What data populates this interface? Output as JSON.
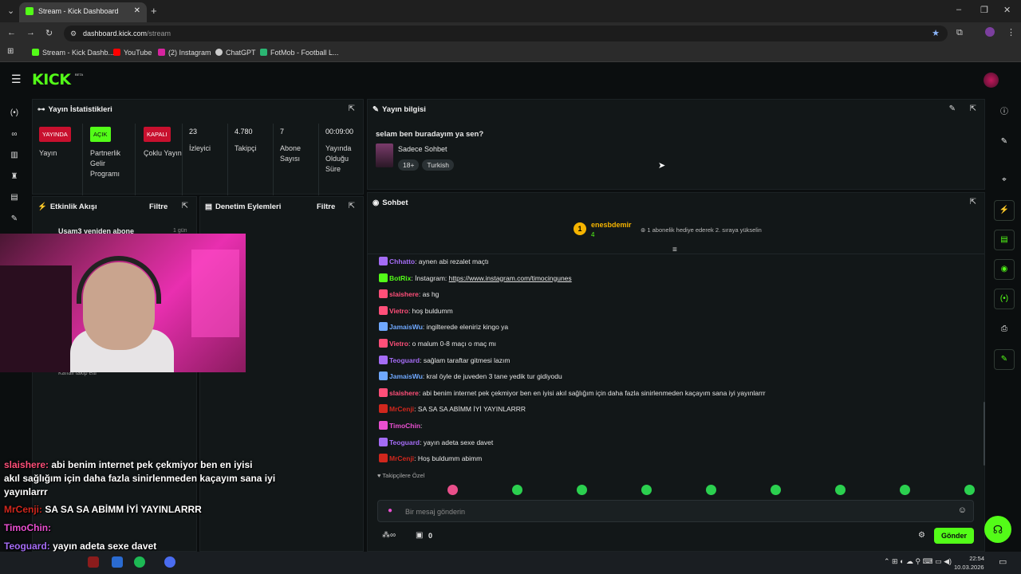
{
  "browser": {
    "tab_title": "Stream - Kick Dashboard",
    "url_host": "dashboard.kick.com",
    "url_path": "/stream",
    "bookmarks": [
      "Stream - Kick Dashb...",
      "YouTube",
      "(2) Instagram",
      "ChatGPT",
      "FotMob - Football L..."
    ]
  },
  "app": {
    "logo": "KICK",
    "beta": "BETA"
  },
  "stats": {
    "title": "Yayın İstatistikleri",
    "items": [
      {
        "badge": "YAYINDA",
        "label": "Yayın",
        "color": "#c8102e"
      },
      {
        "badge": "AÇIK",
        "label": "Partnerlik Gelir Programı",
        "color": "#53fc18"
      },
      {
        "badge": "KAPALI",
        "label": "Çoklu Yayın",
        "color": "#c8102e"
      },
      {
        "value": "23",
        "label": "İzleyici"
      },
      {
        "value": "4.780",
        "label": "Takipçi"
      },
      {
        "value": "7",
        "label": "Abone Sayısı"
      },
      {
        "value": "00:09:00",
        "label": "Yayında Olduğu Süre"
      }
    ]
  },
  "info": {
    "title": "Yayın bilgisi",
    "stream_title": "selam ben buradayım ya sen?",
    "category": "Sadece Sohbet",
    "tags": [
      "18+",
      "Turkish"
    ]
  },
  "activity": {
    "title": "Etkinlik Akışı",
    "filter": "Filtre",
    "first_item": "Usam3 yeniden abone",
    "first_time": "1 gün",
    "partial_item": "Kanalı takip etti"
  },
  "moderation": {
    "title": "Denetim Eylemleri",
    "filter": "Filtre"
  },
  "chat": {
    "title": "Sohbet",
    "top_gifter": "enesbdemir",
    "top_gifter_count": "4",
    "gift_hint": "1 abonelik hediye ederek 2. sıraya yükselin",
    "messages": [
      {
        "user": "Chhatto",
        "text": "aynen abi rezalet maçtı",
        "color": "#a46cf5"
      },
      {
        "user": "BotRix",
        "text": "İnstagram: ",
        "link": "https://www.instagram.com/timocingunes",
        "color": "#53fc18"
      },
      {
        "user": "slaishere",
        "text": "as hg",
        "color": "#ff4f79"
      },
      {
        "user": "Vietro",
        "text": "hoş buldumm",
        "color": "#ff4f79"
      },
      {
        "user": "JamaisWu",
        "text": "ingilterede eleniriz kingo ya",
        "color": "#6fa8ff"
      },
      {
        "user": "Vietro",
        "text": "o malum 0-8 maçı o maç mı",
        "color": "#ff4f79"
      },
      {
        "user": "Teoguard",
        "text": "sağlam taraftar gitmesi lazım",
        "color": "#a46cf5"
      },
      {
        "user": "JamaisWu",
        "text": "kral öyle de juveden 3 tane yedik tur gidiyodu",
        "color": "#6fa8ff"
      },
      {
        "user": "slaishere",
        "text": "abi benim internet pek çekmiyor ben en iyisi akıl sağlığım için daha fazla sinirlenmeden kaçayım sana iyi yayınlarrr",
        "color": "#ff4f79"
      },
      {
        "user": "MrCenji",
        "text": "SA SA SA ABİMM İYİ YAYINLARRR",
        "color": "#d0271d"
      },
      {
        "user": "TimoChin",
        "text": "",
        "color": "#e94fd0"
      },
      {
        "user": "Teoguard",
        "text": "yayın adeta sexe davet",
        "color": "#a46cf5"
      },
      {
        "user": "MrCenji",
        "text": "Hoş buldumm abimm",
        "color": "#d0271d"
      }
    ],
    "emote_label": "Takipçilere Özel",
    "input_placeholder": "Bir mesaj gönderin",
    "points": "0",
    "send": "Gönder"
  },
  "overlay": [
    {
      "user": "slaishere:",
      "text": " abi benim internet pek çekmiyor ben en iyisi",
      "color": "#ff4f79"
    },
    {
      "user": "",
      "text": "akıl sağlığım için daha fazla sinirlenmeden kaçayım sana iyi",
      "color": "#fff"
    },
    {
      "user": "",
      "text": "yayınlarrr",
      "color": "#fff"
    },
    {
      "user": "MrCenji:",
      "text": " SA SA SA ABİMM İYİ YAYINLARRR",
      "color": "#d0271d"
    },
    {
      "user": "TimoChin:",
      "text": "",
      "color": "#e94fd0"
    },
    {
      "user": "Teoguard:",
      "text": " yayın adeta sexe davet",
      "color": "#a46cf5"
    },
    {
      "user": "MrCenji:",
      "text": " Hoş buldumm abimm",
      "color": "#d0271d"
    }
  ],
  "taskbar": {
    "time": "22:54",
    "date": "10.03.2026"
  }
}
